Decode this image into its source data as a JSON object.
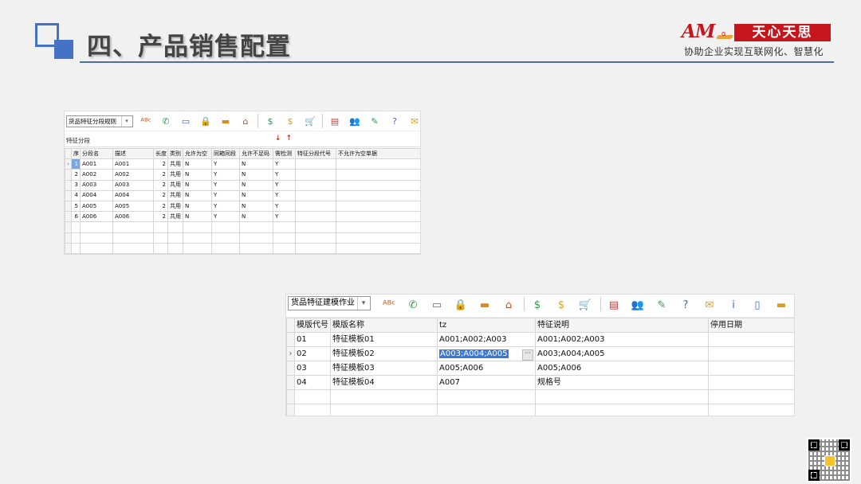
{
  "slide": {
    "title": "四、产品销售配置",
    "brand_text": "天心天思",
    "brand_mark": "AM",
    "brand_mark_sub": "G",
    "tagline": "协助企业实现互联网化、智慧化"
  },
  "window1": {
    "combo_value": "货品特征分段规则",
    "subtitle": "特征分段",
    "red_arrows": "↓↑",
    "toolbar_icons": [
      {
        "name": "abc-icon",
        "glyph": "ᴬᴮᶜ",
        "color": "#c05a1c"
      },
      {
        "name": "phone-icon",
        "glyph": "✆",
        "color": "#2a9a4a"
      },
      {
        "name": "monitor-icon",
        "glyph": "▭",
        "color": "#3a6ccf"
      },
      {
        "name": "lock-icon",
        "glyph": "🔒",
        "color": "#d9a020"
      },
      {
        "name": "briefcase-icon",
        "glyph": "▬",
        "color": "#d98a20"
      },
      {
        "name": "house-icon",
        "glyph": "⌂",
        "color": "#b8502a"
      },
      {
        "name": "dollar-icon",
        "glyph": "$",
        "color": "#2a9a4a"
      },
      {
        "name": "moneybag-icon",
        "glyph": "$",
        "color": "#d9a020"
      },
      {
        "name": "cart-icon",
        "glyph": "🛒",
        "color": "#2a9a4a"
      },
      {
        "name": "report-icon",
        "glyph": "▤",
        "color": "#c04040"
      },
      {
        "name": "users-icon",
        "glyph": "👥",
        "color": "#3a6ccf"
      },
      {
        "name": "tools-icon",
        "glyph": "✎",
        "color": "#2a9a4a"
      },
      {
        "name": "help-icon",
        "glyph": "?",
        "color": "#3a6ccf"
      },
      {
        "name": "mail-icon",
        "glyph": "✉",
        "color": "#d9a020"
      }
    ],
    "columns": [
      "序",
      "分段名",
      "描述",
      "长度",
      "类别",
      "允许为空",
      "同箱同段",
      "允许不足码",
      "需检测",
      "特征分段代号",
      "不允许为空单据"
    ],
    "rows": [
      [
        "1",
        "A001",
        "A001",
        "2",
        "共用",
        "N",
        "Y",
        "N",
        "Y",
        "",
        ""
      ],
      [
        "2",
        "A002",
        "A002",
        "2",
        "共用",
        "N",
        "Y",
        "N",
        "Y",
        "",
        ""
      ],
      [
        "3",
        "A003",
        "A003",
        "2",
        "共用",
        "N",
        "Y",
        "N",
        "Y",
        "",
        ""
      ],
      [
        "4",
        "A004",
        "A004",
        "2",
        "共用",
        "N",
        "Y",
        "N",
        "Y",
        "",
        ""
      ],
      [
        "5",
        "A005",
        "A005",
        "2",
        "共用",
        "N",
        "Y",
        "N",
        "Y",
        "",
        ""
      ],
      [
        "6",
        "A006",
        "A006",
        "2",
        "共用",
        "N",
        "Y",
        "N",
        "Y",
        "",
        ""
      ]
    ]
  },
  "window2": {
    "combo_value": "货品特征建模作业",
    "toolbar_icons": [
      {
        "name": "abc-icon",
        "glyph": "ᴬᴮᶜ",
        "color": "#c05a1c"
      },
      {
        "name": "phone-icon",
        "glyph": "✆",
        "color": "#2a9a4a"
      },
      {
        "name": "monitor-icon",
        "glyph": "▭",
        "color": "#3a6ccf"
      },
      {
        "name": "lock-icon",
        "glyph": "🔒",
        "color": "#d9a020"
      },
      {
        "name": "briefcase-icon",
        "glyph": "▬",
        "color": "#d98a20"
      },
      {
        "name": "house-icon",
        "glyph": "⌂",
        "color": "#b8502a"
      },
      {
        "name": "dollar-icon",
        "glyph": "$",
        "color": "#2a9a4a"
      },
      {
        "name": "moneybag-icon",
        "glyph": "$",
        "color": "#d9a020"
      },
      {
        "name": "cart-icon",
        "glyph": "🛒",
        "color": "#2a9a4a"
      },
      {
        "name": "report-icon",
        "glyph": "▤",
        "color": "#c04040"
      },
      {
        "name": "users-icon",
        "glyph": "👥",
        "color": "#3a6ccf"
      },
      {
        "name": "tools-icon",
        "glyph": "✎",
        "color": "#2a9a4a"
      },
      {
        "name": "help-icon",
        "glyph": "?",
        "color": "#3a6ccf"
      },
      {
        "name": "mail-icon",
        "glyph": "✉",
        "color": "#d9a020"
      },
      {
        "name": "info-icon",
        "glyph": "i",
        "color": "#3a6ccf"
      },
      {
        "name": "document-icon",
        "glyph": "▯",
        "color": "#3a6ccf"
      },
      {
        "name": "folder-icon",
        "glyph": "▬",
        "color": "#d9a020"
      }
    ],
    "columns": [
      "模版代号",
      "模版名称",
      "tz",
      "特征说明",
      "停用日期"
    ],
    "rows": [
      [
        "01",
        "特征模板01",
        "A001;A002;A003",
        "A001;A002;A003",
        ""
      ],
      [
        "02",
        "特征模板02",
        "A003;A004;A005",
        "A003;A004;A005",
        ""
      ],
      [
        "03",
        "特征模板03",
        "A005;A006",
        "A005;A006",
        ""
      ],
      [
        "04",
        "特征模板04",
        "A007",
        "规格号",
        ""
      ]
    ],
    "selected_row": 1,
    "ellipsis_label": "···"
  }
}
